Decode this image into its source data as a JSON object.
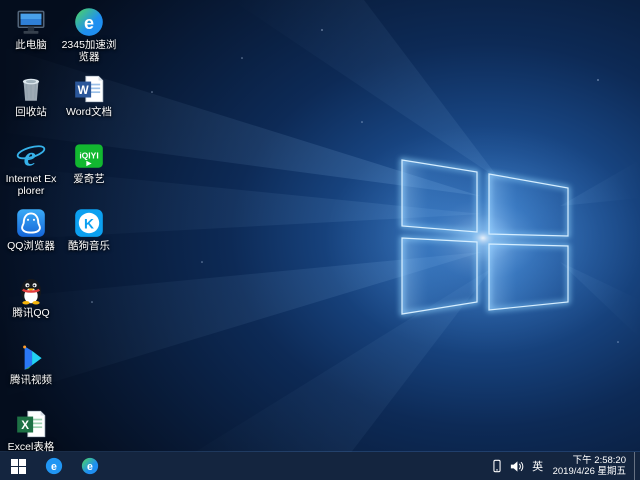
{
  "colors": {
    "taskbar_bg": "#14253f",
    "wallpaper_core_glow": "#3b82d8",
    "wallpaper_edge": "#050e1e",
    "icon_label": "#ffffff"
  },
  "desktop": {
    "column1": [
      {
        "label": "此电脑",
        "icon": "this-pc-icon"
      },
      {
        "label": "回收站",
        "icon": "recycle-bin-icon"
      },
      {
        "label": "Internet Explorer",
        "icon": "internet-explorer-icon"
      },
      {
        "label": "QQ浏览器",
        "icon": "qq-browser-icon"
      },
      {
        "label": "腾讯QQ",
        "icon": "tencent-qq-icon"
      },
      {
        "label": "腾讯视频",
        "icon": "tencent-video-icon"
      },
      {
        "label": "Excel表格",
        "icon": "excel-icon"
      }
    ],
    "column2": [
      {
        "label": "2345加速浏览器",
        "icon": "2345-browser-icon"
      },
      {
        "label": "Word文档",
        "icon": "word-icon"
      },
      {
        "label": "爱奇艺",
        "icon": "iqiyi-icon"
      },
      {
        "label": "酷狗音乐",
        "icon": "kugou-music-icon"
      }
    ]
  },
  "taskbar": {
    "start_icon": "windows-logo",
    "pinned": [
      {
        "icon": "browser-e-blue-icon"
      },
      {
        "icon": "browser-e-2345-icon"
      }
    ],
    "tray": {
      "icons": [
        "phone-icon",
        "volume-icon"
      ],
      "language": "英",
      "time": "下午 2:58:20",
      "date": "2019/4/26 星期五"
    }
  }
}
